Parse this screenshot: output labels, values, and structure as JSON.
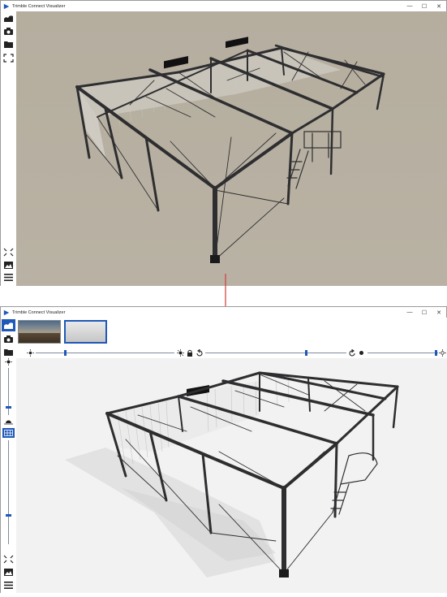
{
  "app": {
    "title": "Trimble Connect Visualizer"
  },
  "window_controls": {
    "minimize": "—",
    "maximize": "☐",
    "close": "✕"
  },
  "before": {
    "toolbar_icons": [
      "environment-icon",
      "camera-icon",
      "folder-icon",
      "fullscreen-icon",
      "fit-view-icon",
      "image-icon",
      "menu-icon"
    ]
  },
  "after": {
    "thumbnails": [
      "sky-environment-thumbnail",
      "studio-environment-thumbnail"
    ],
    "selected_thumbnail": 1,
    "sliders": {
      "brightness": 0.21,
      "rotation": 0.71,
      "exposure": 0.97,
      "sun_height": 0.18,
      "ground_grid": 0.72
    }
  },
  "colors": {
    "accent": "#1e58b8",
    "arrow": "#d23a3a",
    "before_background": "#b5ae9f",
    "after_background": "#f2f2f2",
    "steel": "#2e2e30"
  }
}
